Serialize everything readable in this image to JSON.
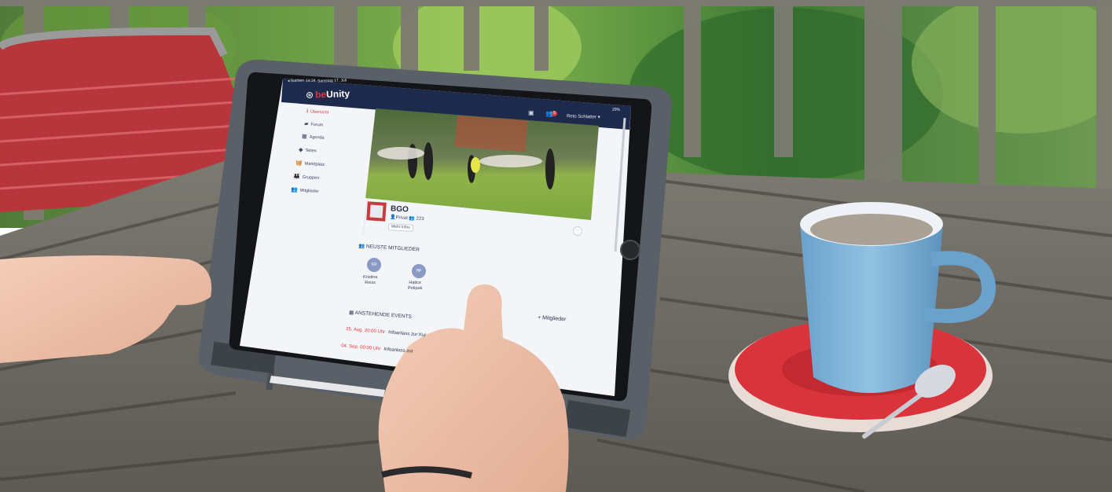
{
  "photo": {
    "description_colors": {
      "tablet_frame": "#5c626c",
      "app_header": "#1d2a4c",
      "accent_red": "#e0373b",
      "cup_blue": "#7fb3d8",
      "saucer_red": "#d9333b",
      "table_wood": "#6f6a62",
      "foliage_green": "#4f8a3a"
    }
  },
  "status_bar": {
    "back": "◂ Suchen",
    "time": "14:34",
    "date": "Samstag 17. Juli",
    "battery": "29%"
  },
  "app": {
    "logo_mark": "⊛",
    "logo_be": "be",
    "logo_unity": "Unity",
    "user_name": "Reto Schlatter ▾",
    "notification_count": "5",
    "message_icon": "▣",
    "notification_icon": "👥"
  },
  "sidebar": {
    "items": [
      {
        "label": "Übersicht",
        "icon": "i"
      },
      {
        "label": "Forum",
        "icon": "▰"
      },
      {
        "label": "Agenda",
        "icon": "▦"
      },
      {
        "label": "Teilen",
        "icon": "◆"
      },
      {
        "label": "Marktplatz",
        "icon": "🧺"
      },
      {
        "label": "Gruppen",
        "icon": "👪"
      },
      {
        "label": "Mitglieder",
        "icon": "👥"
      }
    ]
  },
  "group": {
    "name": "BGO",
    "meta": "👤Privat  👥 223",
    "more_button": "Mehr Infos",
    "ellipsis": "···"
  },
  "members": {
    "title": "👥   NEUSTE MITGLIEDER",
    "list": [
      {
        "initials": "KR",
        "first": "Kristina",
        "last": "Reiss"
      },
      {
        "initials": "HP",
        "first": "Hatice",
        "last": "Pekpak"
      }
    ]
  },
  "events": {
    "title": "▦   ANSTEHENDE EVENTS",
    "add_members": "+ Mitglieder",
    "list": [
      {
        "date": "25. Aug. 20:00 Uhr",
        "title": "Infoanlass zur Kur"
      },
      {
        "date": "04. Sep. 00:00 Uhr",
        "title": "Infoanlass zur"
      }
    ]
  }
}
